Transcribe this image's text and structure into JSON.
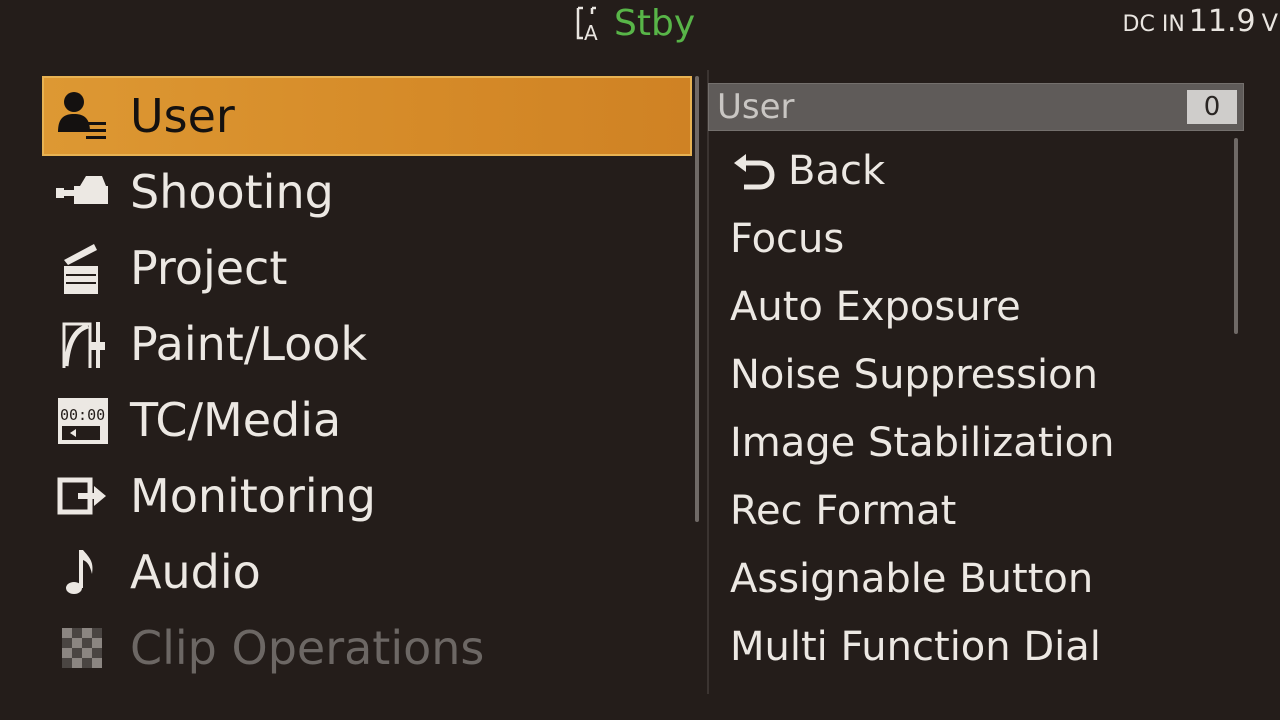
{
  "status": {
    "media_badge": "A",
    "mode": "Stby",
    "power_label": "DC IN",
    "power_value": "11.9",
    "power_unit": "V",
    "mode_color": "#58b548"
  },
  "left_menu": {
    "selected_color": "#dd9833",
    "items": [
      {
        "label": "User",
        "icon": "user-icon",
        "state": "selected"
      },
      {
        "label": "Shooting",
        "icon": "camera-icon",
        "state": "normal"
      },
      {
        "label": "Project",
        "icon": "clapperboard-icon",
        "state": "normal"
      },
      {
        "label": "Paint/Look",
        "icon": "paint-curve-icon",
        "state": "normal"
      },
      {
        "label": "TC/Media",
        "icon": "timecode-icon",
        "state": "normal"
      },
      {
        "label": "Monitoring",
        "icon": "output-icon",
        "state": "normal"
      },
      {
        "label": "Audio",
        "icon": "music-note-icon",
        "state": "normal"
      },
      {
        "label": "Clip Operations",
        "icon": "checker-icon",
        "state": "disabled"
      }
    ]
  },
  "submenu": {
    "title": "User",
    "badge": "0",
    "items": [
      {
        "label": "Back",
        "icon": "back-arrow-icon"
      },
      {
        "label": "Focus"
      },
      {
        "label": "Auto Exposure"
      },
      {
        "label": "Noise Suppression"
      },
      {
        "label": "Image Stabilization"
      },
      {
        "label": "Rec Format"
      },
      {
        "label": "Assignable Button"
      },
      {
        "label": "Multi Function Dial"
      }
    ]
  }
}
